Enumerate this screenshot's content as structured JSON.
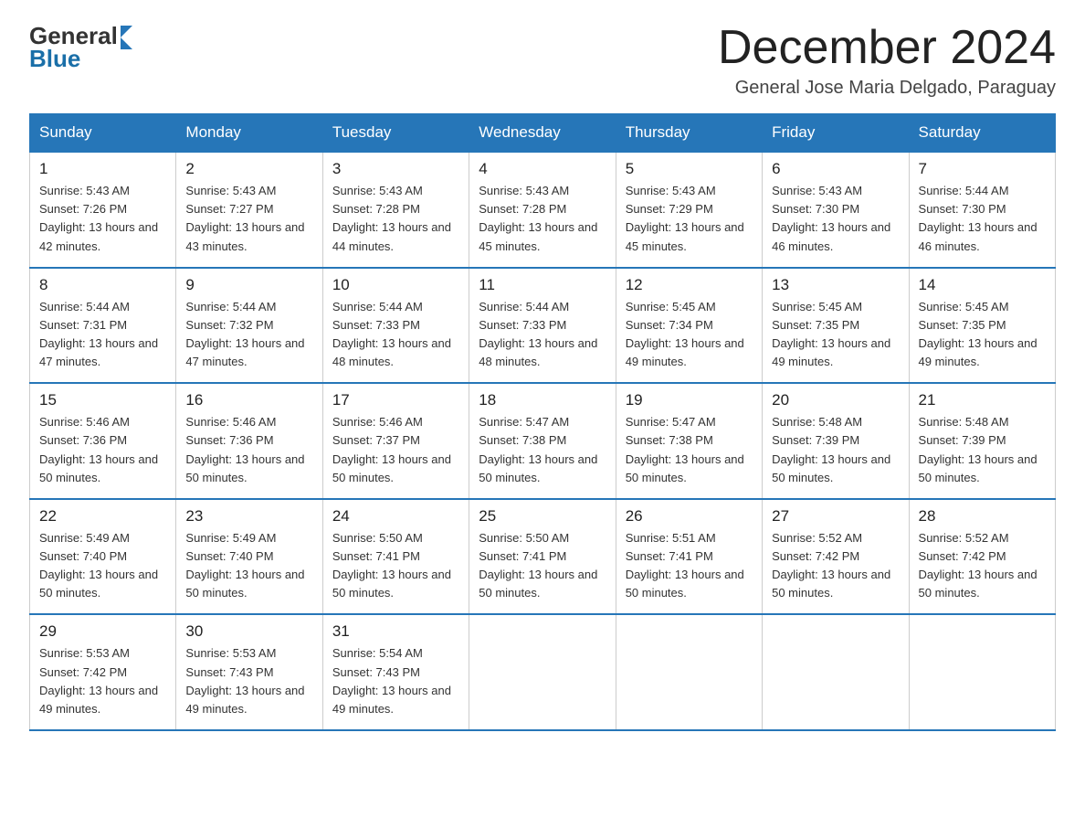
{
  "logo": {
    "text_general": "General",
    "text_blue": "Blue"
  },
  "title": "December 2024",
  "subtitle": "General Jose Maria Delgado, Paraguay",
  "days_header": [
    "Sunday",
    "Monday",
    "Tuesday",
    "Wednesday",
    "Thursday",
    "Friday",
    "Saturday"
  ],
  "weeks": [
    [
      {
        "day": "1",
        "sunrise": "5:43 AM",
        "sunset": "7:26 PM",
        "daylight": "13 hours and 42 minutes."
      },
      {
        "day": "2",
        "sunrise": "5:43 AM",
        "sunset": "7:27 PM",
        "daylight": "13 hours and 43 minutes."
      },
      {
        "day": "3",
        "sunrise": "5:43 AM",
        "sunset": "7:28 PM",
        "daylight": "13 hours and 44 minutes."
      },
      {
        "day": "4",
        "sunrise": "5:43 AM",
        "sunset": "7:28 PM",
        "daylight": "13 hours and 45 minutes."
      },
      {
        "day": "5",
        "sunrise": "5:43 AM",
        "sunset": "7:29 PM",
        "daylight": "13 hours and 45 minutes."
      },
      {
        "day": "6",
        "sunrise": "5:43 AM",
        "sunset": "7:30 PM",
        "daylight": "13 hours and 46 minutes."
      },
      {
        "day": "7",
        "sunrise": "5:44 AM",
        "sunset": "7:30 PM",
        "daylight": "13 hours and 46 minutes."
      }
    ],
    [
      {
        "day": "8",
        "sunrise": "5:44 AM",
        "sunset": "7:31 PM",
        "daylight": "13 hours and 47 minutes."
      },
      {
        "day": "9",
        "sunrise": "5:44 AM",
        "sunset": "7:32 PM",
        "daylight": "13 hours and 47 minutes."
      },
      {
        "day": "10",
        "sunrise": "5:44 AM",
        "sunset": "7:33 PM",
        "daylight": "13 hours and 48 minutes."
      },
      {
        "day": "11",
        "sunrise": "5:44 AM",
        "sunset": "7:33 PM",
        "daylight": "13 hours and 48 minutes."
      },
      {
        "day": "12",
        "sunrise": "5:45 AM",
        "sunset": "7:34 PM",
        "daylight": "13 hours and 49 minutes."
      },
      {
        "day": "13",
        "sunrise": "5:45 AM",
        "sunset": "7:35 PM",
        "daylight": "13 hours and 49 minutes."
      },
      {
        "day": "14",
        "sunrise": "5:45 AM",
        "sunset": "7:35 PM",
        "daylight": "13 hours and 49 minutes."
      }
    ],
    [
      {
        "day": "15",
        "sunrise": "5:46 AM",
        "sunset": "7:36 PM",
        "daylight": "13 hours and 50 minutes."
      },
      {
        "day": "16",
        "sunrise": "5:46 AM",
        "sunset": "7:36 PM",
        "daylight": "13 hours and 50 minutes."
      },
      {
        "day": "17",
        "sunrise": "5:46 AM",
        "sunset": "7:37 PM",
        "daylight": "13 hours and 50 minutes."
      },
      {
        "day": "18",
        "sunrise": "5:47 AM",
        "sunset": "7:38 PM",
        "daylight": "13 hours and 50 minutes."
      },
      {
        "day": "19",
        "sunrise": "5:47 AM",
        "sunset": "7:38 PM",
        "daylight": "13 hours and 50 minutes."
      },
      {
        "day": "20",
        "sunrise": "5:48 AM",
        "sunset": "7:39 PM",
        "daylight": "13 hours and 50 minutes."
      },
      {
        "day": "21",
        "sunrise": "5:48 AM",
        "sunset": "7:39 PM",
        "daylight": "13 hours and 50 minutes."
      }
    ],
    [
      {
        "day": "22",
        "sunrise": "5:49 AM",
        "sunset": "7:40 PM",
        "daylight": "13 hours and 50 minutes."
      },
      {
        "day": "23",
        "sunrise": "5:49 AM",
        "sunset": "7:40 PM",
        "daylight": "13 hours and 50 minutes."
      },
      {
        "day": "24",
        "sunrise": "5:50 AM",
        "sunset": "7:41 PM",
        "daylight": "13 hours and 50 minutes."
      },
      {
        "day": "25",
        "sunrise": "5:50 AM",
        "sunset": "7:41 PM",
        "daylight": "13 hours and 50 minutes."
      },
      {
        "day": "26",
        "sunrise": "5:51 AM",
        "sunset": "7:41 PM",
        "daylight": "13 hours and 50 minutes."
      },
      {
        "day": "27",
        "sunrise": "5:52 AM",
        "sunset": "7:42 PM",
        "daylight": "13 hours and 50 minutes."
      },
      {
        "day": "28",
        "sunrise": "5:52 AM",
        "sunset": "7:42 PM",
        "daylight": "13 hours and 50 minutes."
      }
    ],
    [
      {
        "day": "29",
        "sunrise": "5:53 AM",
        "sunset": "7:42 PM",
        "daylight": "13 hours and 49 minutes."
      },
      {
        "day": "30",
        "sunrise": "5:53 AM",
        "sunset": "7:43 PM",
        "daylight": "13 hours and 49 minutes."
      },
      {
        "day": "31",
        "sunrise": "5:54 AM",
        "sunset": "7:43 PM",
        "daylight": "13 hours and 49 minutes."
      },
      null,
      null,
      null,
      null
    ]
  ],
  "labels": {
    "sunrise_prefix": "Sunrise: ",
    "sunset_prefix": "Sunset: ",
    "daylight_prefix": "Daylight: "
  }
}
